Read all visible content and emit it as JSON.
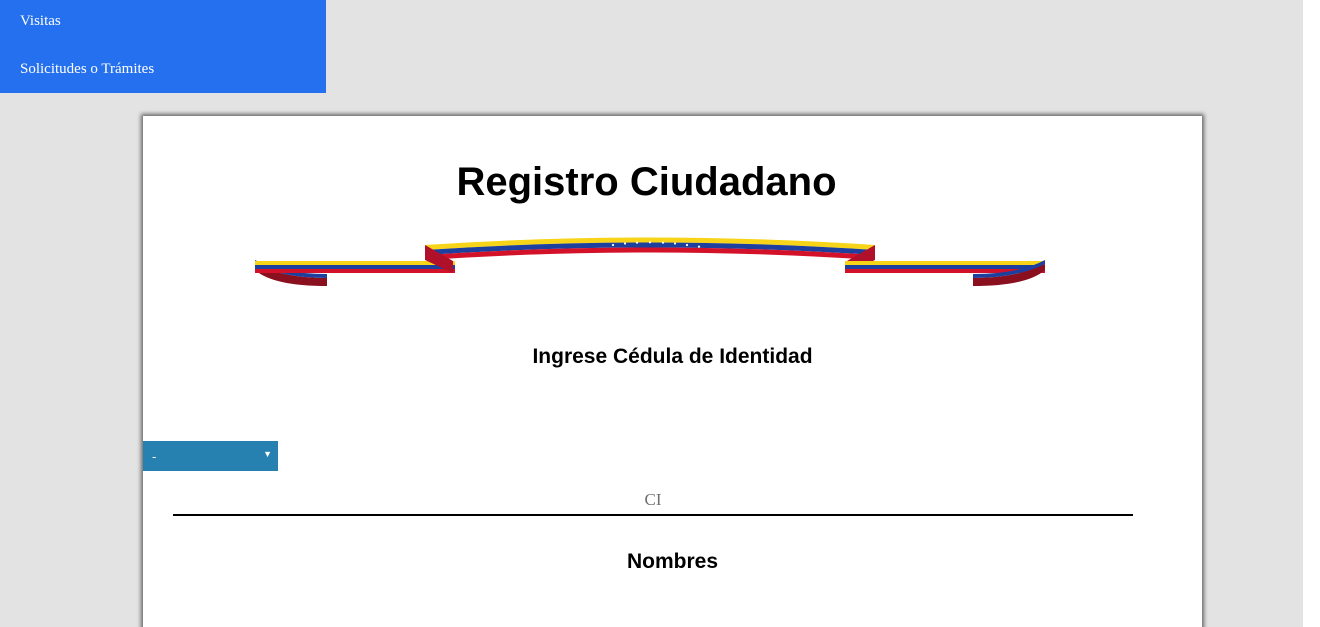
{
  "menu": {
    "items": [
      {
        "label": "Visitas"
      },
      {
        "label": "Solicitudes o Trámites"
      }
    ],
    "background": "#2570ef"
  },
  "form": {
    "title": "Registro Ciudadano",
    "ci_heading": "Ingrese Cédula de Identidad",
    "doc_type": {
      "selected": "-",
      "color": "#2680b0"
    },
    "ci_input": {
      "placeholder": "CI",
      "value": ""
    },
    "names_heading": "Nombres"
  },
  "ribbon": {
    "icon": "venezuela-flag-ribbon",
    "colors": [
      "#f7d417",
      "#1d3f9e",
      "#d3122a"
    ]
  }
}
